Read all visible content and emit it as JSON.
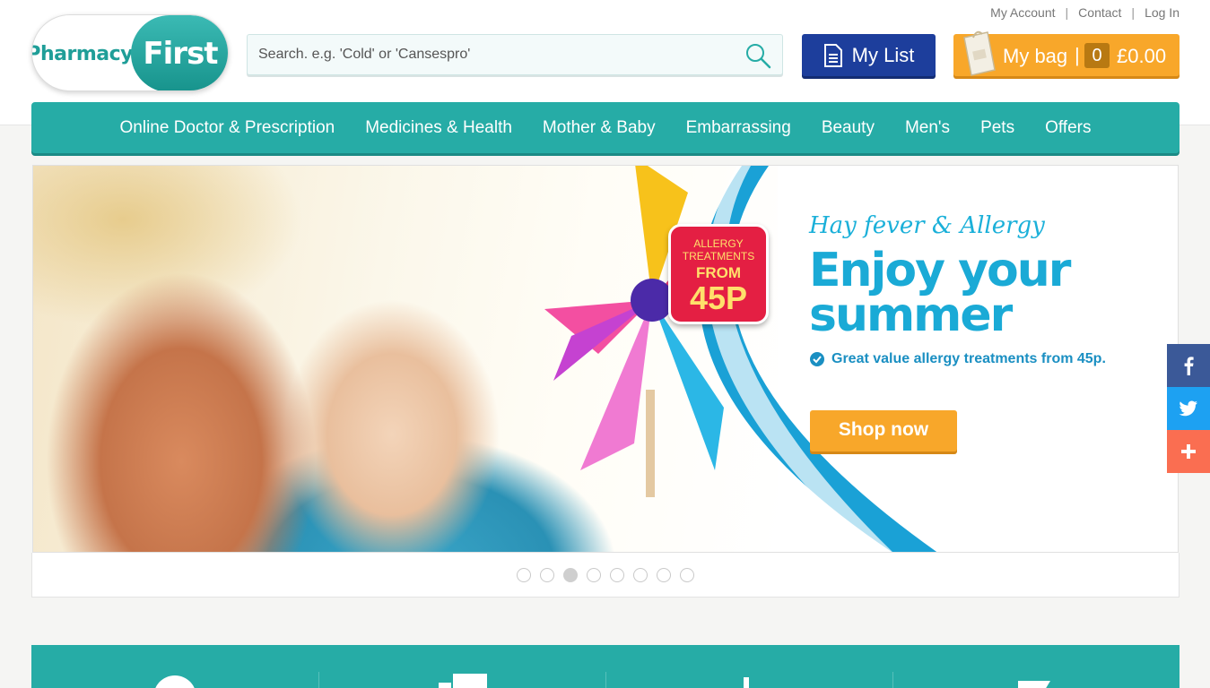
{
  "toplinks": {
    "my_account": "My Account",
    "contact": "Contact",
    "log_in": "Log In",
    "separator": "|"
  },
  "logo": {
    "left_text": "Pharmacy",
    "right_text": "First"
  },
  "search": {
    "placeholder": "Search. e.g. 'Cold' or 'Cansespro'"
  },
  "my_list": {
    "label": "My List"
  },
  "my_bag": {
    "label": "My bag",
    "separator": "|",
    "count": "0",
    "total": "£0.00"
  },
  "nav": {
    "items": [
      "Online Doctor & Prescription",
      "Medicines & Health",
      "Mother & Baby",
      "Embarrassing",
      "Beauty",
      "Men's",
      "Pets",
      "Offers"
    ]
  },
  "banner": {
    "badge_line1": "ALLERGY TREATMENTS",
    "badge_line2": "FROM",
    "badge_line3": "45P",
    "script_title": "Hay fever & Allergy",
    "headline": "Enjoy your summer",
    "bullet": "Great value allergy treatments from 45p.",
    "cta": "Shop now"
  },
  "carousel": {
    "dot_count": 8,
    "active_index": 2
  },
  "colors": {
    "teal": "#26aca6",
    "navy": "#1d3e9c",
    "orange": "#f8a72a",
    "facebook": "#3b5998",
    "twitter": "#1da1f2",
    "share": "#fa6e51"
  },
  "social_icons": [
    "facebook-icon",
    "twitter-icon",
    "plus-icon"
  ]
}
